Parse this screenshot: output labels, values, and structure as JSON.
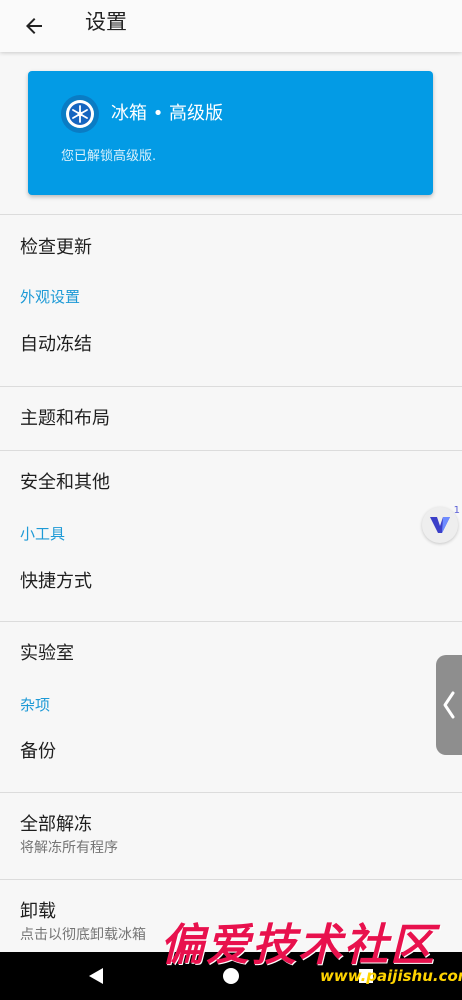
{
  "appbar": {
    "back_icon": "arrow-left-icon",
    "title": "设置"
  },
  "premium": {
    "logo_icon": "icebox-logo-icon",
    "title": "冰箱 • 高级版",
    "subtitle": "您已解锁高级版.",
    "color": "#039be5"
  },
  "list": {
    "check_update": "检查更新",
    "appearance_header": "外观设置",
    "auto_freeze": "自动冻结",
    "theme_layout": "主题和布局",
    "security_other": "安全和其他",
    "tools_header": "小工具",
    "shortcuts": "快捷方式",
    "lab": "实验室",
    "misc_header": "杂项",
    "backup": "备份",
    "unfreeze_all": "全部解冻",
    "unfreeze_all_sub": "将解冻所有程序",
    "uninstall": "卸载",
    "uninstall_sub": "点击以彻底卸载冰箱"
  },
  "overlay": {
    "float_v_icon": "v-assistant-icon",
    "float_v_badge": "1",
    "side_handle_icon": "chevron-left-icon"
  },
  "navbar": {
    "back_icon": "triangle-back-icon",
    "home_icon": "circle-home-icon",
    "recents_icon": "square-recents-icon"
  },
  "watermark": {
    "main": "偏爱技术社区",
    "url": "www.paijishu.com"
  },
  "colors": {
    "section_header": "#1e9ad6",
    "background": "#f7f7f7",
    "watermark_red": "#e8114d",
    "watermark_yellow": "#ffd400"
  }
}
